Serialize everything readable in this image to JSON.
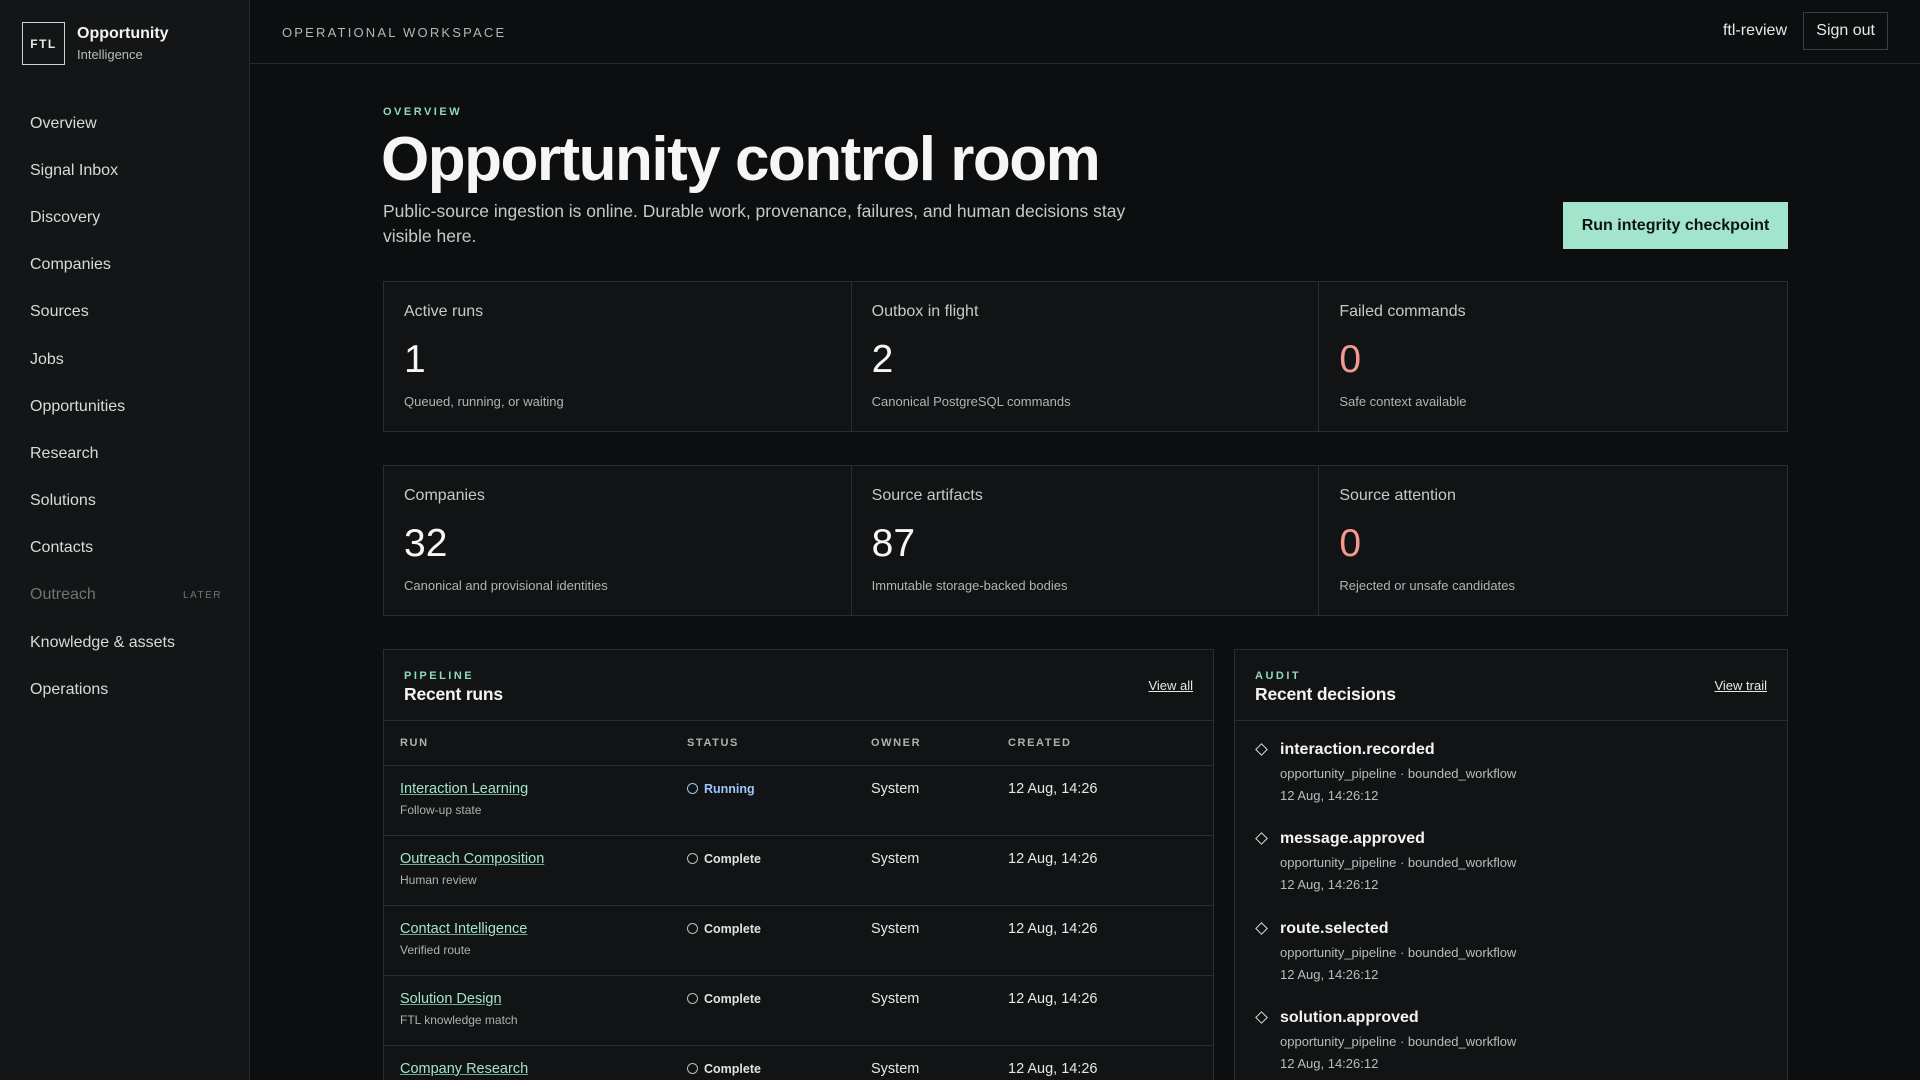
{
  "brand": {
    "mark": "FTL",
    "title": "Opportunity",
    "subtitle": "Intelligence"
  },
  "nav": [
    {
      "label": "Overview"
    },
    {
      "label": "Signal Inbox"
    },
    {
      "label": "Discovery"
    },
    {
      "label": "Companies"
    },
    {
      "label": "Sources"
    },
    {
      "label": "Jobs"
    },
    {
      "label": "Opportunities"
    },
    {
      "label": "Research"
    },
    {
      "label": "Solutions"
    },
    {
      "label": "Contacts"
    },
    {
      "label": "Outreach",
      "tag": "LATER"
    },
    {
      "label": "Knowledge & assets"
    },
    {
      "label": "Operations"
    }
  ],
  "topbar": {
    "workspace": "OPERATIONAL WORKSPACE",
    "user": "ftl-review",
    "signout": "Sign out"
  },
  "header": {
    "eyebrow": "OVERVIEW",
    "title": "Opportunity control room",
    "description": "Public-source ingestion is online. Durable work, provenance, failures, and human decisions stay visible here.",
    "cta": "Run integrity checkpoint"
  },
  "stats_row1": [
    {
      "label": "Active runs",
      "value": "1",
      "note": "Queued, running, or waiting"
    },
    {
      "label": "Outbox in flight",
      "value": "2",
      "note": "Canonical PostgreSQL commands"
    },
    {
      "label": "Failed commands",
      "value": "0",
      "note": "Safe context available"
    }
  ],
  "stats_row2": [
    {
      "label": "Companies",
      "value": "32",
      "note": "Canonical and provisional identities"
    },
    {
      "label": "Source artifacts",
      "value": "87",
      "note": "Immutable storage-backed bodies"
    },
    {
      "label": "Source attention",
      "value": "0",
      "note": "Rejected or unsafe candidates"
    }
  ],
  "colors": {
    "accent": "#a3e4cd",
    "alert": "#f29a8f",
    "running": "#9ec5ff"
  },
  "runs": {
    "eyebrow": "PIPELINE",
    "title": "Recent runs",
    "link": "View all",
    "columns": {
      "run": "RUN",
      "status": "STATUS",
      "owner": "OWNER",
      "created": "CREATED"
    },
    "rows": [
      {
        "name": "Interaction Learning",
        "sub": "Follow-up state",
        "status": "Running",
        "owner": "System",
        "created": "12 Aug, 14:26"
      },
      {
        "name": "Outreach Composition",
        "sub": "Human review",
        "status": "Complete",
        "owner": "System",
        "created": "12 Aug, 14:26"
      },
      {
        "name": "Contact Intelligence",
        "sub": "Verified route",
        "status": "Complete",
        "owner": "System",
        "created": "12 Aug, 14:26"
      },
      {
        "name": "Solution Design",
        "sub": "FTL knowledge match",
        "status": "Complete",
        "owner": "System",
        "created": "12 Aug, 14:26"
      },
      {
        "name": "Company Research",
        "sub": "",
        "status": "Complete",
        "owner": "System",
        "created": "12 Aug, 14:26"
      }
    ]
  },
  "audit": {
    "eyebrow": "AUDIT",
    "title": "Recent decisions",
    "link": "View trail",
    "items": [
      {
        "title": "interaction.recorded",
        "meta": "opportunity_pipeline · bounded_workflow",
        "time": "12 Aug, 14:26:12"
      },
      {
        "title": "message.approved",
        "meta": "opportunity_pipeline · bounded_workflow",
        "time": "12 Aug, 14:26:12"
      },
      {
        "title": "route.selected",
        "meta": "opportunity_pipeline · bounded_workflow",
        "time": "12 Aug, 14:26:12"
      },
      {
        "title": "solution.approved",
        "meta": "opportunity_pipeline · bounded_workflow",
        "time": "12 Aug, 14:26:12"
      }
    ]
  }
}
